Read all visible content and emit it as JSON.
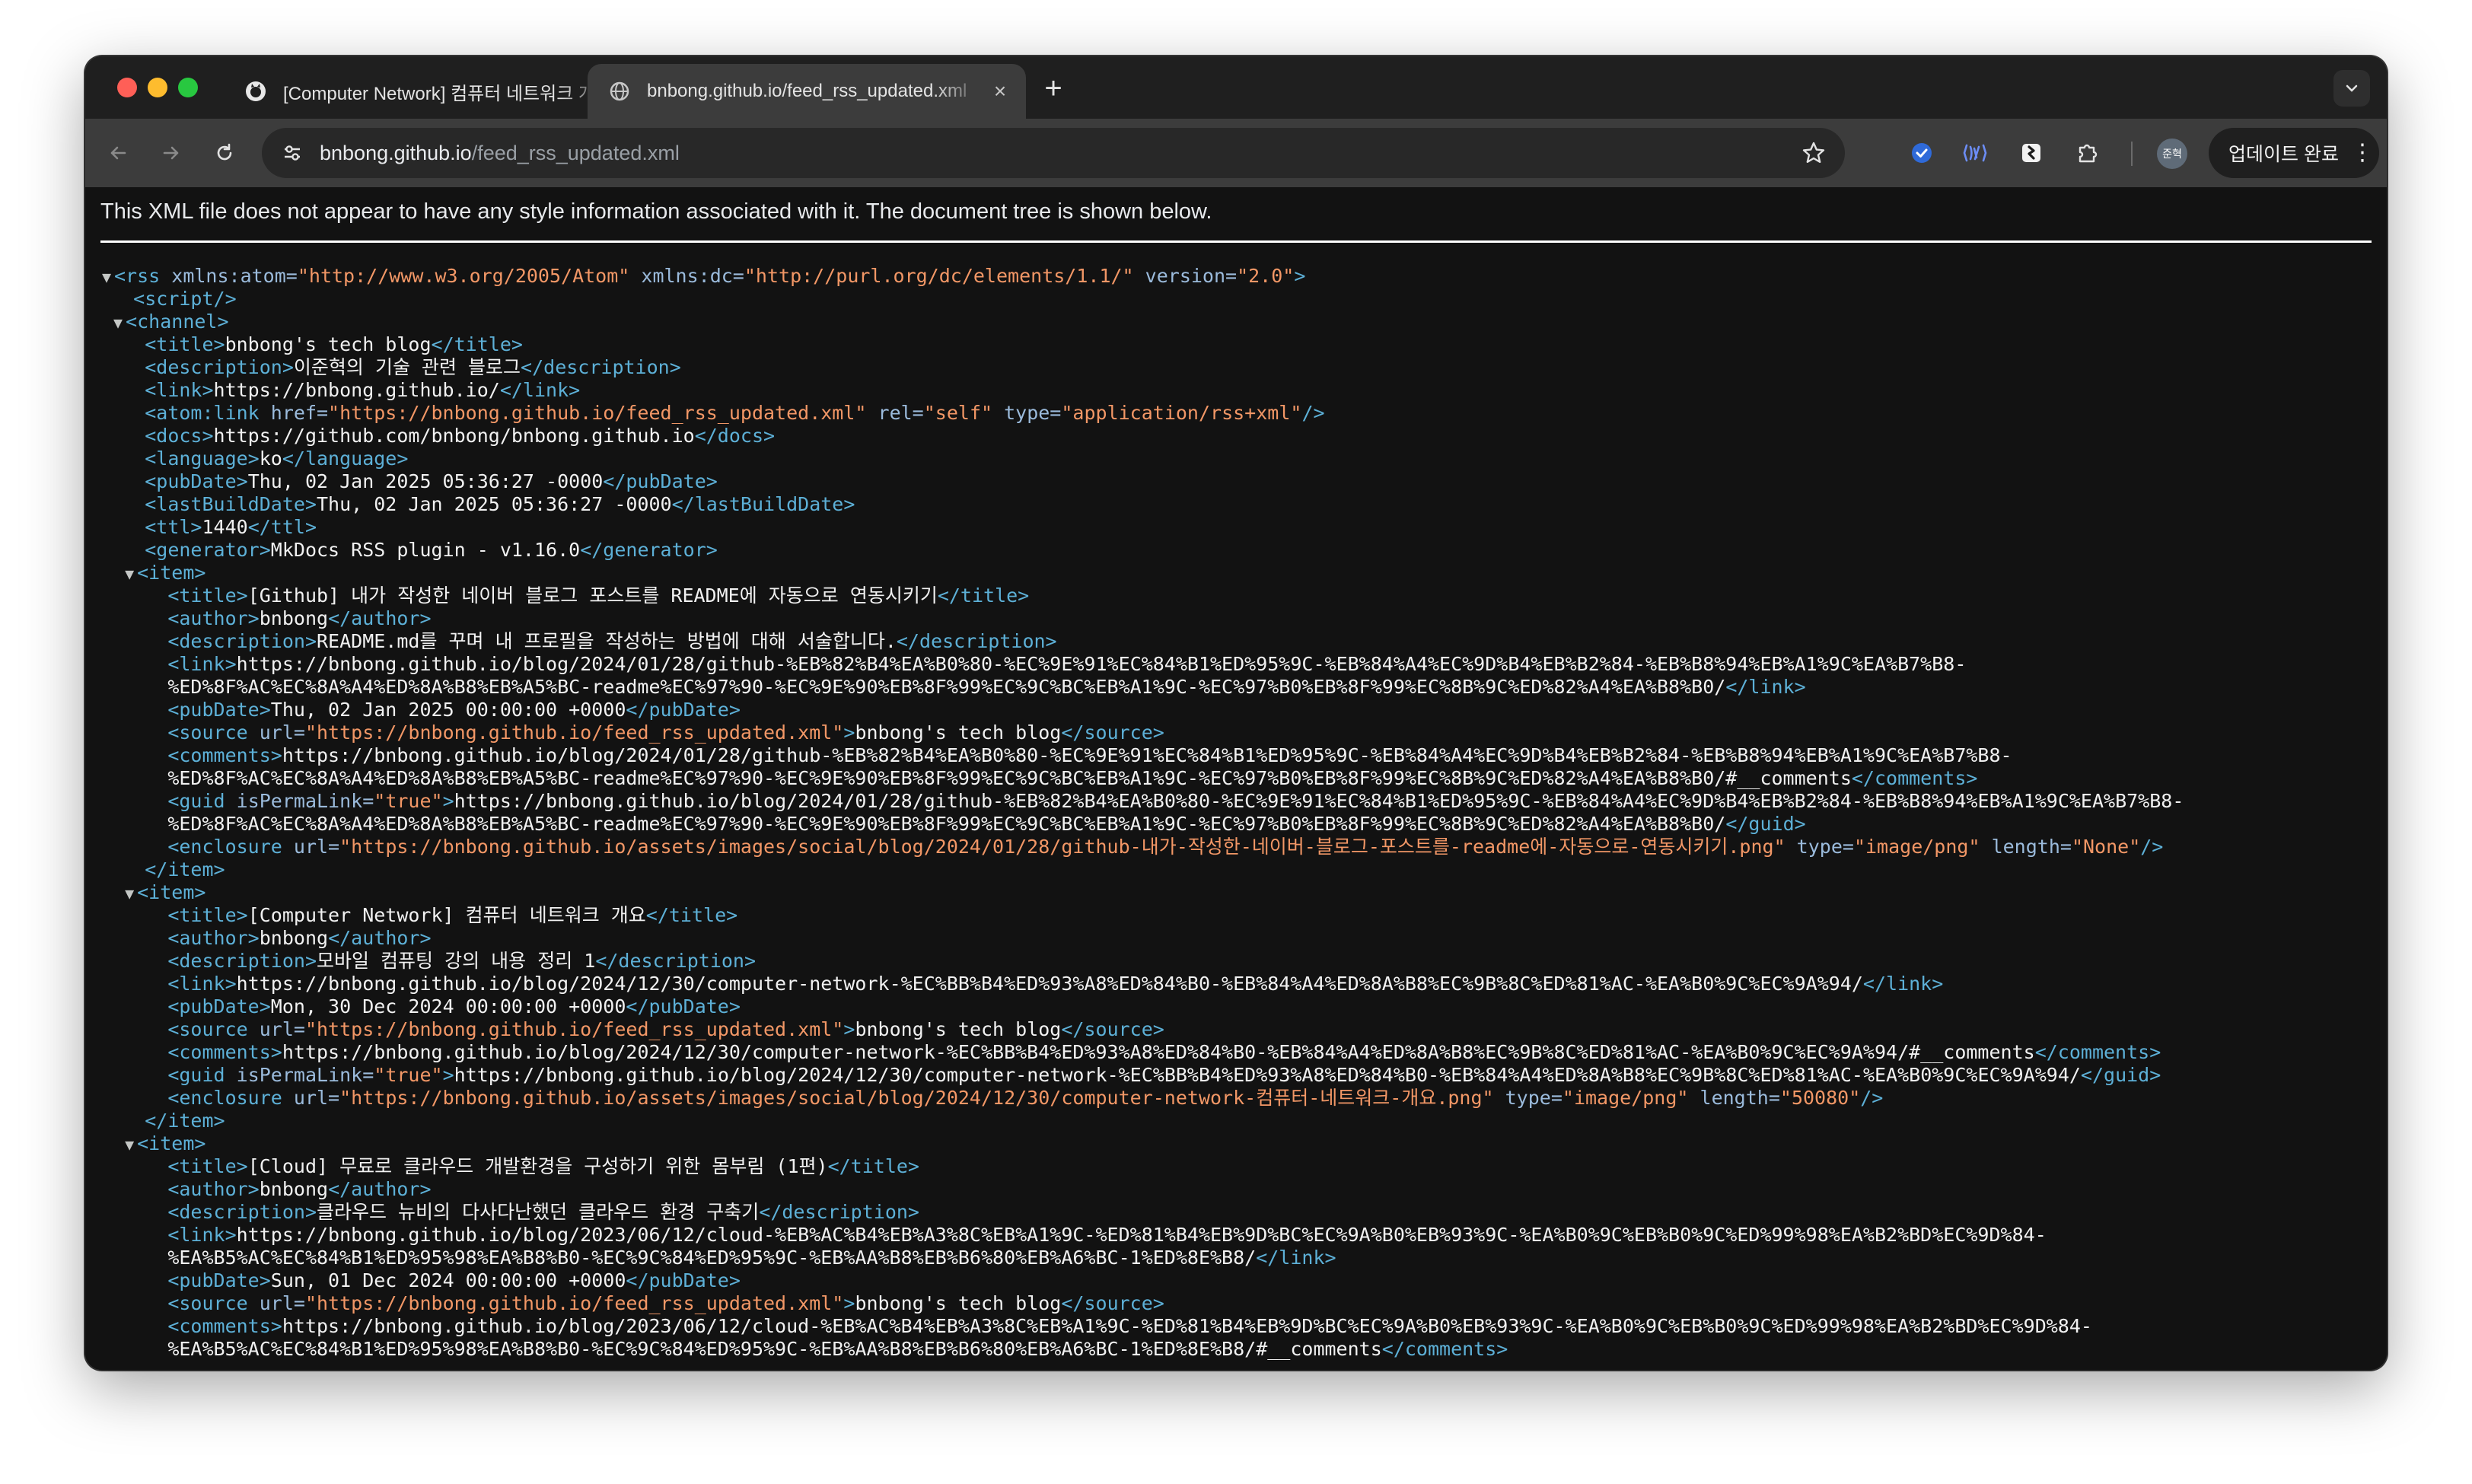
{
  "tabs": [
    {
      "title": "[Computer Network] 컴퓨터 네트워크 개요",
      "favicon": "octocat-icon",
      "active": false
    },
    {
      "title": "bnbong.github.io/feed_rss_updated.xml",
      "favicon": "globe-icon",
      "active": true
    }
  ],
  "toolbar": {
    "url_host": "bnbong.github.io",
    "url_path": "/feed_rss_updated.xml",
    "profile_label": "준혁",
    "update_label": "업데이트 완료"
  },
  "notice": "This XML file does not appear to have any style information associated with it. The document tree is shown below.",
  "colors": {
    "tag": "#5db0d7",
    "attr_name": "#9bbbdc",
    "attr_value": "#f29766",
    "text": "#f1f1f1",
    "background": "#121212"
  },
  "xml": {
    "rss_attrs": [
      {
        "name": "xmlns:atom",
        "value": "http://www.w3.org/2005/Atom"
      },
      {
        "name": "xmlns:dc",
        "value": "http://purl.org/dc/elements/1.1/"
      },
      {
        "name": "version",
        "value": "2.0"
      }
    ],
    "channel": {
      "title": "bnbong's tech blog",
      "description": "이준혁의 기술 관련 블로그",
      "link": "https://bnbong.github.io/",
      "atom_link_attrs": [
        {
          "name": "href",
          "value": "https://bnbong.github.io/feed_rss_updated.xml"
        },
        {
          "name": "rel",
          "value": "self"
        },
        {
          "name": "type",
          "value": "application/rss+xml"
        }
      ],
      "docs": "https://github.com/bnbong/bnbong.github.io",
      "language": "ko",
      "pubDate": "Thu, 02 Jan 2025 05:36:27 -0000",
      "lastBuildDate": "Thu, 02 Jan 2025 05:36:27 -0000",
      "ttl": "1440",
      "generator": "MkDocs RSS plugin - v1.16.0"
    },
    "items": [
      {
        "title": "[Github] 내가 작성한 네이버 블로그 포스트를 README에 자동으로 연동시키기",
        "author": "bnbong",
        "description": "README.md를 꾸며 내 프로필을 작성하는 방법에 대해 서술합니다.",
        "link_1": "https://bnbong.github.io/blog/2024/01/28/github-%EB%82%B4%EA%B0%80-%EC%9E%91%EC%84%B1%ED%95%9C-%EB%84%A4%EC%9D%B4%EB%B2%84-%EB%B8%94%EB%A1%9C%EA%B7%B8-",
        "link_2": "%ED%8F%AC%EC%8A%A4%ED%8A%B8%EB%A5%BC-readme%EC%97%90-%EC%9E%90%EB%8F%99%EC%9C%BC%EB%A1%9C-%EC%97%B0%EB%8F%99%EC%8B%9C%ED%82%A4%EA%B8%B0/",
        "pubDate": "Thu, 02 Jan 2025 00:00:00 +0000",
        "source_url": "https://bnbong.github.io/feed_rss_updated.xml",
        "source_text": "bnbong's tech blog",
        "comments_1": "https://bnbong.github.io/blog/2024/01/28/github-%EB%82%B4%EA%B0%80-%EC%9E%91%EC%84%B1%ED%95%9C-%EB%84%A4%EC%9D%B4%EB%B2%84-%EB%B8%94%EB%A1%9C%EA%B7%B8-",
        "comments_2": "%ED%8F%AC%EC%8A%A4%ED%8A%B8%EB%A5%BC-readme%EC%97%90-%EC%9E%90%EB%8F%99%EC%9C%BC%EB%A1%9C-%EC%97%B0%EB%8F%99%EC%8B%9C%ED%82%A4%EA%B8%B0/#__comments",
        "guid_permalink": "true",
        "guid_1": "https://bnbong.github.io/blog/2024/01/28/github-%EB%82%B4%EA%B0%80-%EC%9E%91%EC%84%B1%ED%95%9C-%EB%84%A4%EC%9D%B4%EB%B2%84-%EB%B8%94%EB%A1%9C%EA%B7%B8-",
        "guid_2": "%ED%8F%AC%EC%8A%A4%ED%8A%B8%EB%A5%BC-readme%EC%97%90-%EC%9E%90%EB%8F%99%EC%9C%BC%EB%A1%9C-%EC%97%B0%EB%8F%99%EC%8B%9C%ED%82%A4%EA%B8%B0/",
        "enclosure_url": "https://bnbong.github.io/assets/images/social/blog/2024/01/28/github-내가-작성한-네이버-블로그-포스트를-readme에-자동으로-연동시키기.png",
        "enclosure_type": "image/png",
        "enclosure_length": "None"
      },
      {
        "title": "[Computer Network] 컴퓨터 네트워크 개요",
        "author": "bnbong",
        "description": "모바일 컴퓨팅 강의 내용 정리 1",
        "link_1": "https://bnbong.github.io/blog/2024/12/30/computer-network-%EC%BB%B4%ED%93%A8%ED%84%B0-%EB%84%A4%ED%8A%B8%EC%9B%8C%ED%81%AC-%EA%B0%9C%EC%9A%94/",
        "pubDate": "Mon, 30 Dec 2024 00:00:00 +0000",
        "source_url": "https://bnbong.github.io/feed_rss_updated.xml",
        "source_text": "bnbong's tech blog",
        "comments_1": "https://bnbong.github.io/blog/2024/12/30/computer-network-%EC%BB%B4%ED%93%A8%ED%84%B0-%EB%84%A4%ED%8A%B8%EC%9B%8C%ED%81%AC-%EA%B0%9C%EC%9A%94/#__comments",
        "guid_permalink": "true",
        "guid_1": "https://bnbong.github.io/blog/2024/12/30/computer-network-%EC%BB%B4%ED%93%A8%ED%84%B0-%EB%84%A4%ED%8A%B8%EC%9B%8C%ED%81%AC-%EA%B0%9C%EC%9A%94/",
        "enclosure_url": "https://bnbong.github.io/assets/images/social/blog/2024/12/30/computer-network-컴퓨터-네트워크-개요.png",
        "enclosure_type": "image/png",
        "enclosure_length": "50080"
      },
      {
        "title": "[Cloud] 무료로 클라우드 개발환경을 구성하기 위한 몸부림 (1편)",
        "author": "bnbong",
        "description": "클라우드 뉴비의 다사다난했던 클라우드 환경 구축기",
        "link_1": "https://bnbong.github.io/blog/2023/06/12/cloud-%EB%AC%B4%EB%A3%8C%EB%A1%9C-%ED%81%B4%EB%9D%BC%EC%9A%B0%EB%93%9C-%EA%B0%9C%EB%B0%9C%ED%99%98%EA%B2%BD%EC%9D%84-",
        "link_2": "%EA%B5%AC%EC%84%B1%ED%95%98%EA%B8%B0-%EC%9C%84%ED%95%9C-%EB%AA%B8%EB%B6%80%EB%A6%BC-1%ED%8E%B8/",
        "pubDate": "Sun, 01 Dec 2024 00:00:00 +0000",
        "source_url": "https://bnbong.github.io/feed_rss_updated.xml",
        "source_text": "bnbong's tech blog",
        "comments_1": "https://bnbong.github.io/blog/2023/06/12/cloud-%EB%AC%B4%EB%A3%8C%EB%A1%9C-%ED%81%B4%EB%9D%BC%EC%9A%B0%EB%93%9C-%EA%B0%9C%EB%B0%9C%ED%99%98%EA%B2%BD%EC%9D%84-",
        "comments_2": "%EA%B5%AC%EC%84%B1%ED%95%98%EA%B8%B0-%EC%9C%84%ED%95%9C-%EB%AA%B8%EB%B6%80%EB%A6%BC-1%ED%8E%B8/#__comments"
      }
    ]
  }
}
